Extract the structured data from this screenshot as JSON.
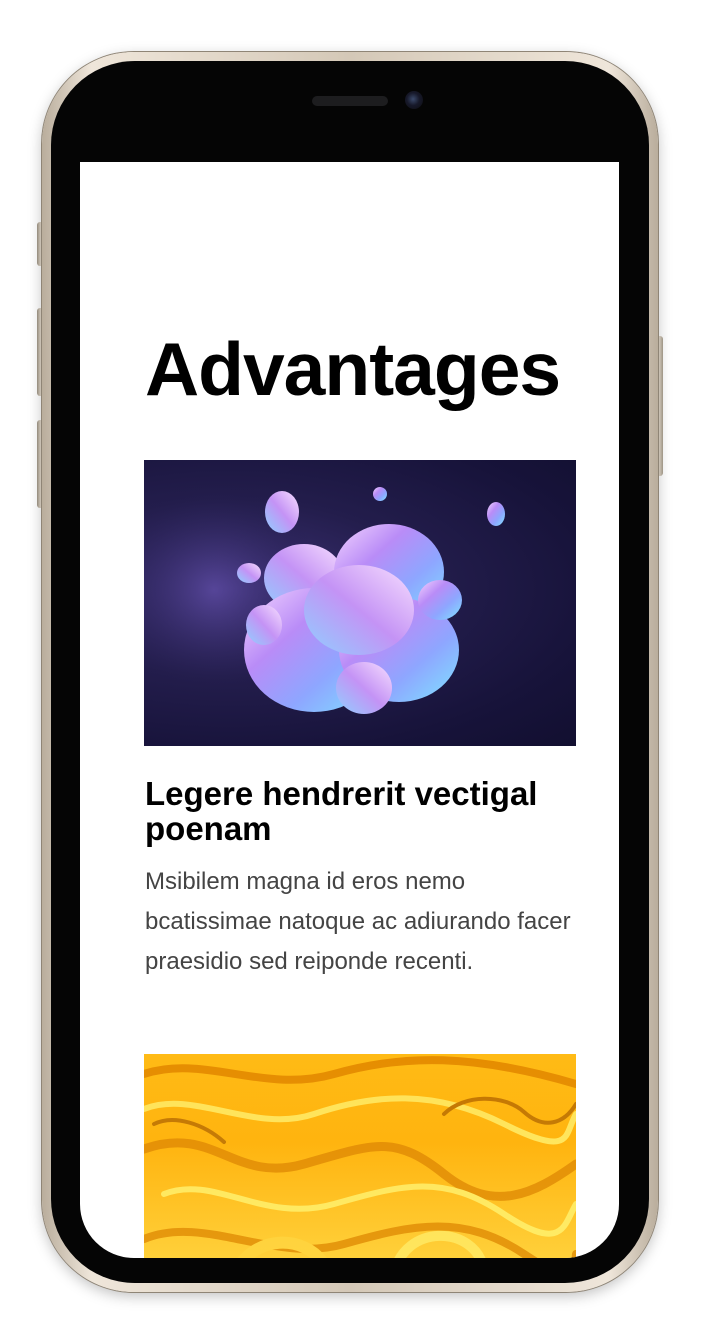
{
  "page": {
    "title": "Advantages"
  },
  "cards": [
    {
      "image_name": "fluid-blobs-image",
      "title": "Legere hendrerit vectigal poenam",
      "text": "Msibilem magna id eros nemo bcatissimae natoque ac adiurando facer praesidio sed reiponde recenti."
    },
    {
      "image_name": "yellow-maze-image"
    }
  ],
  "colors": {
    "frame": "#d4c8b7",
    "bezel": "#050505",
    "screen_bg": "#ffffff",
    "title_text": "#000000",
    "body_text": "#444444",
    "blob_bg": "#1a1640",
    "maze_yellow": "#ffc21a"
  }
}
